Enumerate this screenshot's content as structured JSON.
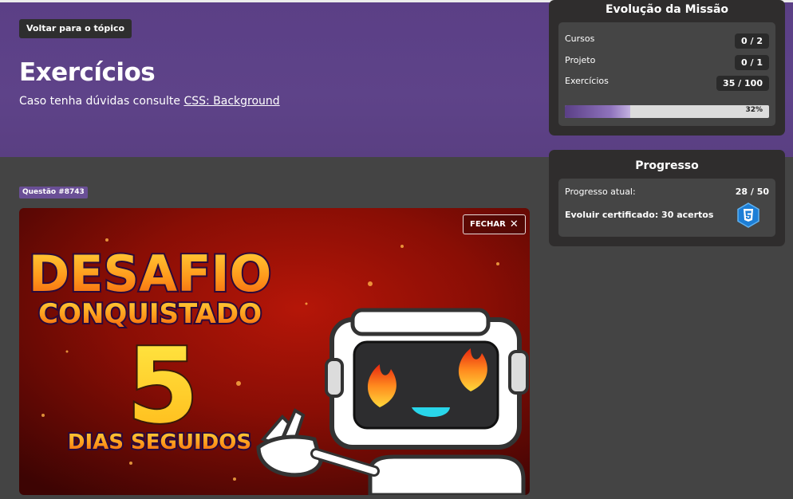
{
  "header": {
    "back_label": "Voltar para o tópico",
    "title": "Exercícios",
    "subtitle_prefix": "Caso tenha dúvidas consulte ",
    "subtitle_link": "CSS: Background"
  },
  "question": {
    "badge": "Questão #8743"
  },
  "banner": {
    "close_label": "FECHAR",
    "line1": "DESAFIO",
    "line2": "CONQUISTADO",
    "number": "5",
    "line3": "DIAS SEGUIDOS"
  },
  "mission": {
    "title": "Evolução da Missão",
    "rows": [
      {
        "label": "Cursos",
        "value": "0 / 2"
      },
      {
        "label": "Projeto",
        "value": "0 / 1"
      },
      {
        "label": "Exercícios",
        "value": "35 / 100"
      }
    ],
    "progress_text": "32%",
    "progress_fraction": 0.32
  },
  "progress": {
    "title": "Progresso",
    "current_label": "Progresso atual:",
    "current_value": "28 / 50",
    "cert_label": "Evoluir certificado: 30 acertos",
    "cert_icon": "css3-shield-icon"
  },
  "colors": {
    "hero": "#5b3f86",
    "page_bg": "#444444",
    "card_bg": "#2f2d2d",
    "accent": "#8f73bd",
    "banner_orange": "#ff8a1e",
    "banner_yellow": "#ffd21f"
  }
}
